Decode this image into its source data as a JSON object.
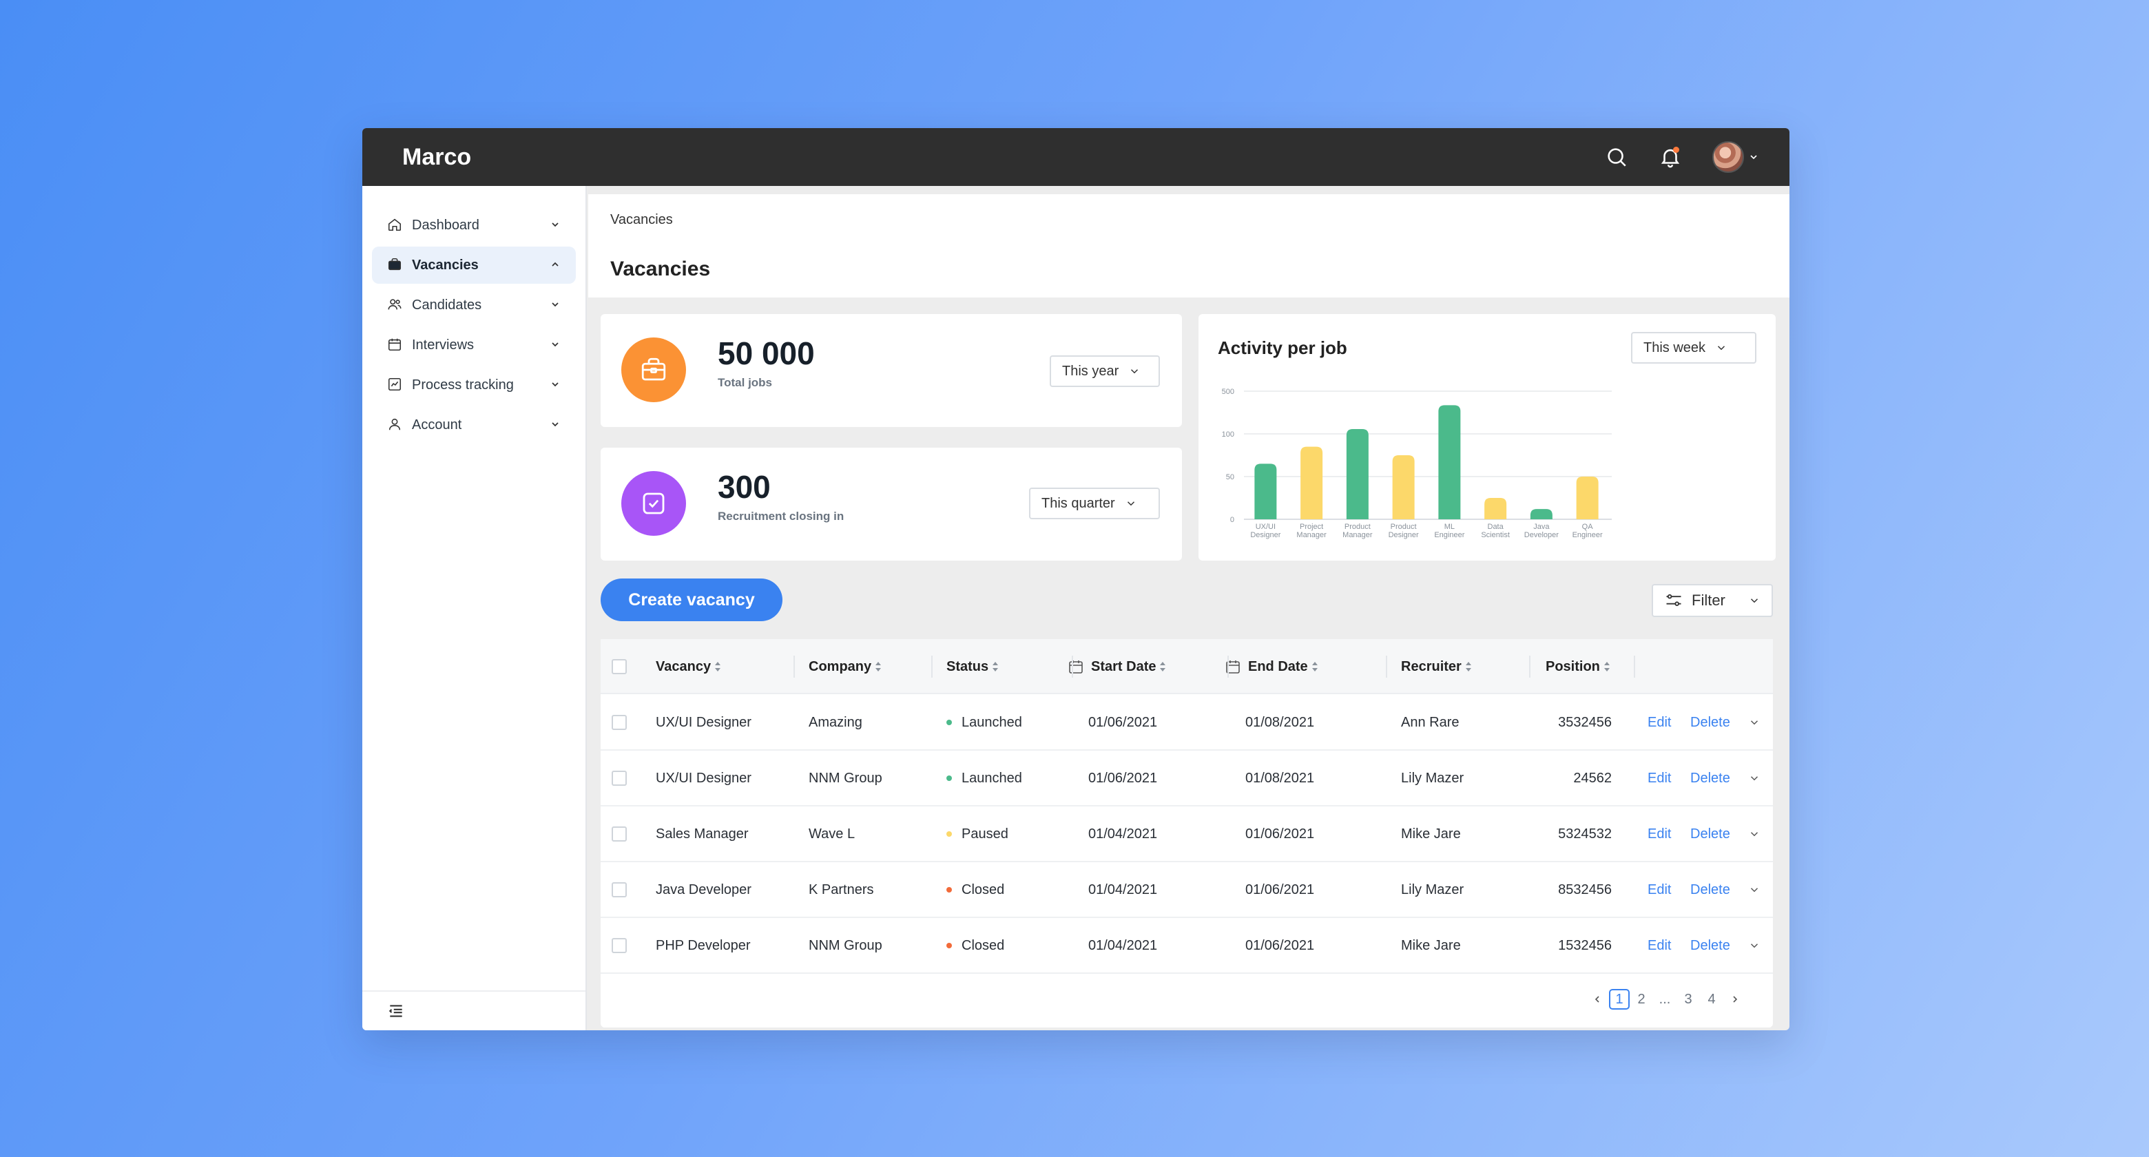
{
  "app": {
    "brand": "Marco"
  },
  "topbar": {
    "search_icon": "search-icon",
    "bell_icon": "bell-icon",
    "avatar": "user-avatar"
  },
  "sidebar": {
    "items": [
      {
        "label": "Dashboard",
        "icon": "home-icon",
        "expanded": false,
        "active": false
      },
      {
        "label": "Vacancies",
        "icon": "briefcase-icon",
        "expanded": true,
        "active": true
      },
      {
        "label": "Candidates",
        "icon": "users-icon",
        "expanded": false,
        "active": false
      },
      {
        "label": "Interviews",
        "icon": "calendar-icon",
        "expanded": false,
        "active": false
      },
      {
        "label": "Process tracking",
        "icon": "chart-icon",
        "expanded": false,
        "active": false
      },
      {
        "label": "Account",
        "icon": "user-icon",
        "expanded": false,
        "active": false
      }
    ],
    "collapse_icon": "menu-collapse-icon"
  },
  "header": {
    "breadcrumb": "Vacancies",
    "title": "Vacancies"
  },
  "stats": [
    {
      "value": "50 000",
      "label": "Total jobs",
      "period": "This year",
      "color": "#fb9234",
      "icon": "briefcase-icon"
    },
    {
      "value": "300",
      "label": "Recruitment closing in",
      "period": "This quarter",
      "color": "#a855f7",
      "icon": "check-square-icon"
    }
  ],
  "chart": {
    "title": "Activity per job",
    "period": "This week"
  },
  "chart_data": {
    "type": "bar",
    "title": "Activity per job",
    "categories": [
      "UX/UI Designer",
      "Project Manager",
      "Product Manager",
      "Product Designer",
      "ML Engineer",
      "Data Scientist",
      "Java Developer",
      "QA Engineer"
    ],
    "category_lines": [
      [
        "UX/UI",
        "Designer"
      ],
      [
        "Project",
        "Manager"
      ],
      [
        "Product",
        "Manager"
      ],
      [
        "Product",
        "Designer"
      ],
      [
        "ML",
        "Engineer"
      ],
      [
        "Data",
        "Scientist"
      ],
      [
        "Java",
        "Developer"
      ],
      [
        "QA",
        "Engineer"
      ]
    ],
    "values": [
      65,
      85,
      107,
      75,
      142,
      25,
      12,
      50
    ],
    "colors": [
      "#4bba8b",
      "#fcd86a",
      "#4bba8b",
      "#fcd86a",
      "#4bba8b",
      "#fcd86a",
      "#4bba8b",
      "#fcd86a"
    ],
    "yticks": [
      0,
      50,
      100,
      500
    ],
    "xlabel": "",
    "ylabel": "",
    "grid": true
  },
  "actions": {
    "create_label": "Create vacancy",
    "filter_label": "Filter"
  },
  "table": {
    "columns": [
      "Vacancy",
      "Company",
      "Status",
      "Start Date",
      "End Date",
      "Recruiter",
      "Position"
    ],
    "rows": [
      {
        "vacancy": "UX/UI Designer",
        "company": "Amazing",
        "status": "Launched",
        "status_color": "#4bba8b",
        "start": "01/06/2021",
        "end": "01/08/2021",
        "recruiter": "Ann Rare",
        "position": "3532456"
      },
      {
        "vacancy": "UX/UI Designer",
        "company": "NNM Group",
        "status": "Launched",
        "status_color": "#4bba8b",
        "start": "01/06/2021",
        "end": "01/08/2021",
        "recruiter": "Lily Mazer",
        "position": "24562"
      },
      {
        "vacancy": "Sales Manager",
        "company": "Wave L",
        "status": "Paused",
        "status_color": "#fcd86a",
        "start": "01/04/2021",
        "end": "01/06/2021",
        "recruiter": "Mike Jare",
        "position": "5324532"
      },
      {
        "vacancy": "Java Developer",
        "company": "K Partners",
        "status": "Closed",
        "status_color": "#f26b3a",
        "start": "01/04/2021",
        "end": "01/06/2021",
        "recruiter": "Lily Mazer",
        "position": "8532456"
      },
      {
        "vacancy": "PHP Developer",
        "company": "NNM Group",
        "status": "Closed",
        "status_color": "#f26b3a",
        "start": "01/04/2021",
        "end": "01/06/2021",
        "recruiter": "Mike Jare",
        "position": "1532456"
      }
    ],
    "edit_label": "Edit",
    "delete_label": "Delete"
  },
  "pagination": {
    "pages": [
      "1",
      "2",
      "...",
      "3",
      "4"
    ],
    "current": "1"
  }
}
